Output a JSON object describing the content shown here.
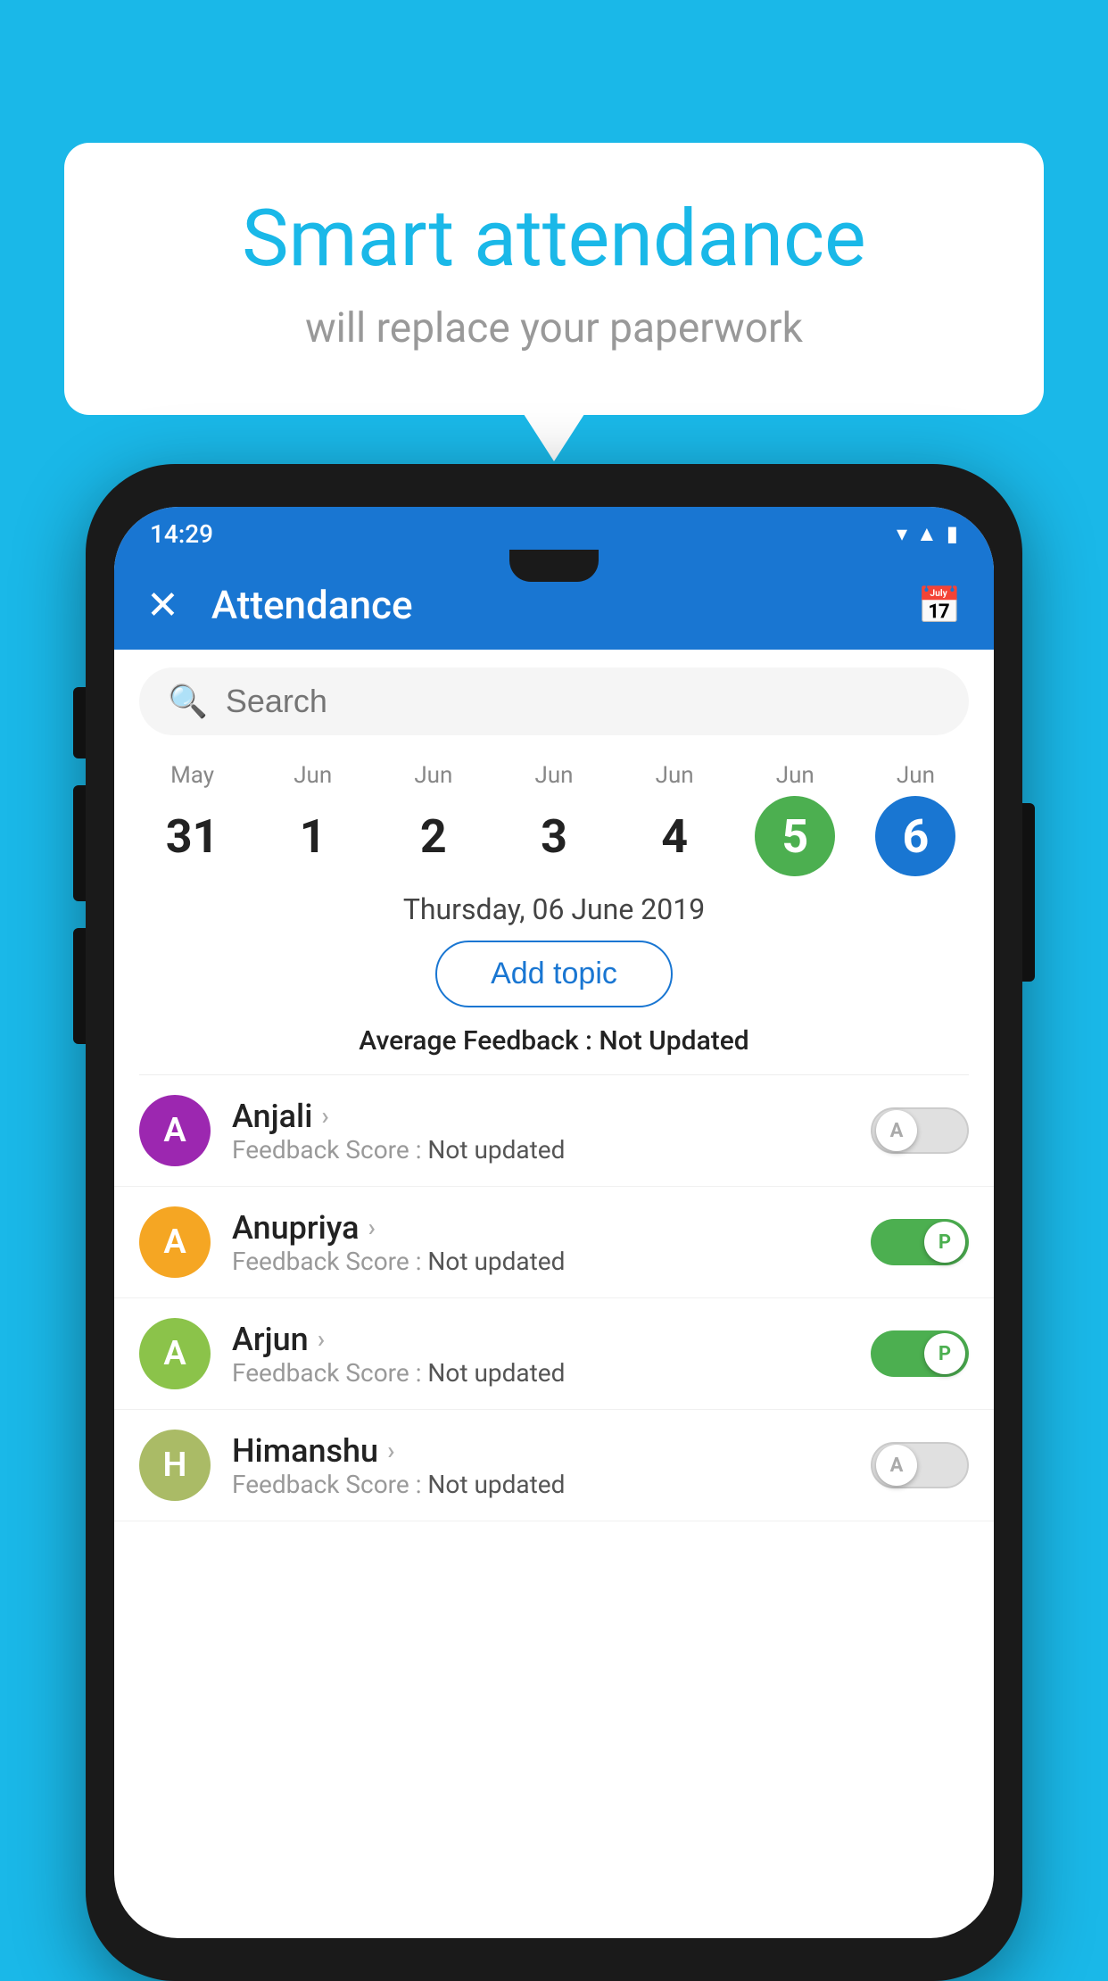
{
  "background_color": "#1ab8e8",
  "bubble": {
    "headline": "Smart attendance",
    "subtext": "will replace your paperwork"
  },
  "status_bar": {
    "time": "14:29",
    "icons": [
      "wifi",
      "signal",
      "battery"
    ]
  },
  "app_bar": {
    "title": "Attendance",
    "close_label": "✕",
    "calendar_icon": "📅"
  },
  "search": {
    "placeholder": "Search"
  },
  "dates": [
    {
      "month": "May",
      "day": "31",
      "style": "normal"
    },
    {
      "month": "Jun",
      "day": "1",
      "style": "normal"
    },
    {
      "month": "Jun",
      "day": "2",
      "style": "normal"
    },
    {
      "month": "Jun",
      "day": "3",
      "style": "normal"
    },
    {
      "month": "Jun",
      "day": "4",
      "style": "normal"
    },
    {
      "month": "Jun",
      "day": "5",
      "style": "today"
    },
    {
      "month": "Jun",
      "day": "6",
      "style": "selected"
    }
  ],
  "selected_date": "Thursday, 06 June 2019",
  "add_topic_label": "Add topic",
  "avg_feedback_label": "Average Feedback : ",
  "avg_feedback_value": "Not Updated",
  "students": [
    {
      "name": "Anjali",
      "avatar_letter": "A",
      "avatar_color": "#9c27b0",
      "feedback_label": "Feedback Score : ",
      "feedback_value": "Not updated",
      "toggle": "off",
      "toggle_label": "A"
    },
    {
      "name": "Anupriya",
      "avatar_letter": "A",
      "avatar_color": "#f5a623",
      "feedback_label": "Feedback Score : ",
      "feedback_value": "Not updated",
      "toggle": "on",
      "toggle_label": "P"
    },
    {
      "name": "Arjun",
      "avatar_letter": "A",
      "avatar_color": "#8bc34a",
      "feedback_label": "Feedback Score : ",
      "feedback_value": "Not updated",
      "toggle": "on",
      "toggle_label": "P"
    },
    {
      "name": "Himanshu",
      "avatar_letter": "H",
      "avatar_color": "#aabb66",
      "feedback_label": "Feedback Score : ",
      "feedback_value": "Not updated",
      "toggle": "off",
      "toggle_label": "A"
    }
  ]
}
